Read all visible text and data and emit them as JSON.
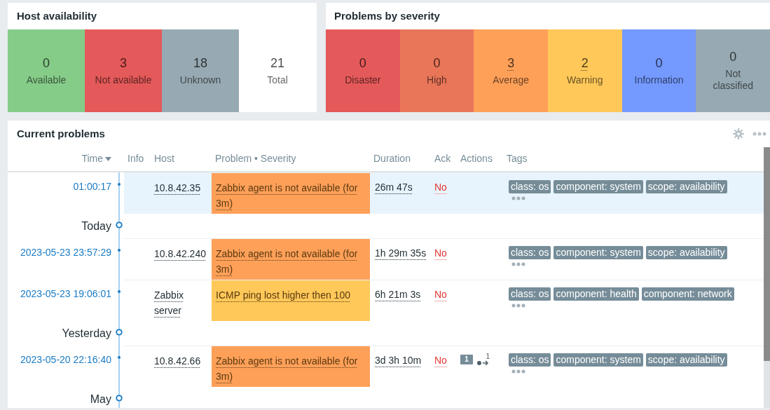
{
  "host_availability": {
    "title": "Host availability",
    "tiles": [
      {
        "count": "0",
        "label": "Available",
        "color": "#86cc89"
      },
      {
        "count": "3",
        "label": "Not available",
        "color": "#e45959"
      },
      {
        "count": "18",
        "label": "Unknown",
        "color": "#97aab3"
      },
      {
        "count": "21",
        "label": "Total",
        "color": "#ffffff"
      }
    ]
  },
  "problems_by_severity": {
    "title": "Problems by severity",
    "tiles": [
      {
        "count": "0",
        "label": "Disaster",
        "color": "#e45959",
        "linked": false
      },
      {
        "count": "0",
        "label": "High",
        "color": "#e97659",
        "linked": false
      },
      {
        "count": "3",
        "label": "Average",
        "color": "#ffa059",
        "linked": true
      },
      {
        "count": "2",
        "label": "Warning",
        "color": "#ffc859",
        "linked": true
      },
      {
        "count": "0",
        "label": "Information",
        "color": "#7499ff",
        "linked": false
      },
      {
        "count": "0",
        "label": "Not classified",
        "color": "#97aab3",
        "linked": false
      }
    ]
  },
  "current_problems": {
    "title": "Current problems",
    "columns": [
      {
        "label": "Time",
        "sorted": true
      },
      {
        "label": "Info",
        "sorted": false
      },
      {
        "label": "Host",
        "sorted": false
      },
      {
        "label": "Problem • Severity",
        "sorted": false
      },
      {
        "label": "Duration",
        "sorted": false
      },
      {
        "label": "Ack",
        "sorted": false
      },
      {
        "label": "Actions",
        "sorted": false
      },
      {
        "label": "Tags",
        "sorted": false
      }
    ],
    "rows": [
      {
        "kind": "problem",
        "selected": true,
        "time": "01:00:17",
        "host": "10.8.42.35",
        "problem": "Zabbix agent is not available (for 3m)",
        "color": "#ffa059",
        "duration": "26m 47s",
        "ack": "No",
        "tags": [
          "class: os",
          "component: system",
          "scope: availability"
        ]
      },
      {
        "kind": "divider",
        "label": "Today"
      },
      {
        "kind": "problem",
        "selected": false,
        "time": "2023-05-23 23:57:29",
        "host": "10.8.42.240",
        "problem": "Zabbix agent is not available (for 3m)",
        "color": "#ffa059",
        "duration": "1h 29m 35s",
        "ack": "No",
        "tags": [
          "class: os",
          "component: system",
          "scope: availability"
        ]
      },
      {
        "kind": "problem",
        "selected": false,
        "time": "2023-05-23 19:06:01",
        "host": "Zabbix server",
        "problem": "ICMP ping lost higher then 100",
        "color": "#ffc859",
        "duration": "6h 21m 3s",
        "ack": "No",
        "tags": [
          "class: os",
          "component: health",
          "component: network"
        ]
      },
      {
        "kind": "divider",
        "label": "Yesterday"
      },
      {
        "kind": "problem",
        "selected": false,
        "time": "2023-05-20 22:16:40",
        "host": "10.8.42.66",
        "problem": "Zabbix agent is not available (for 3m)",
        "color": "#ffa059",
        "duration": "3d 3h 10m",
        "ack": "No",
        "actions": {
          "messages": "1",
          "events": "1"
        },
        "tags": [
          "class: os",
          "component: system",
          "scope: availability"
        ]
      },
      {
        "kind": "divider",
        "label": "May"
      }
    ]
  }
}
